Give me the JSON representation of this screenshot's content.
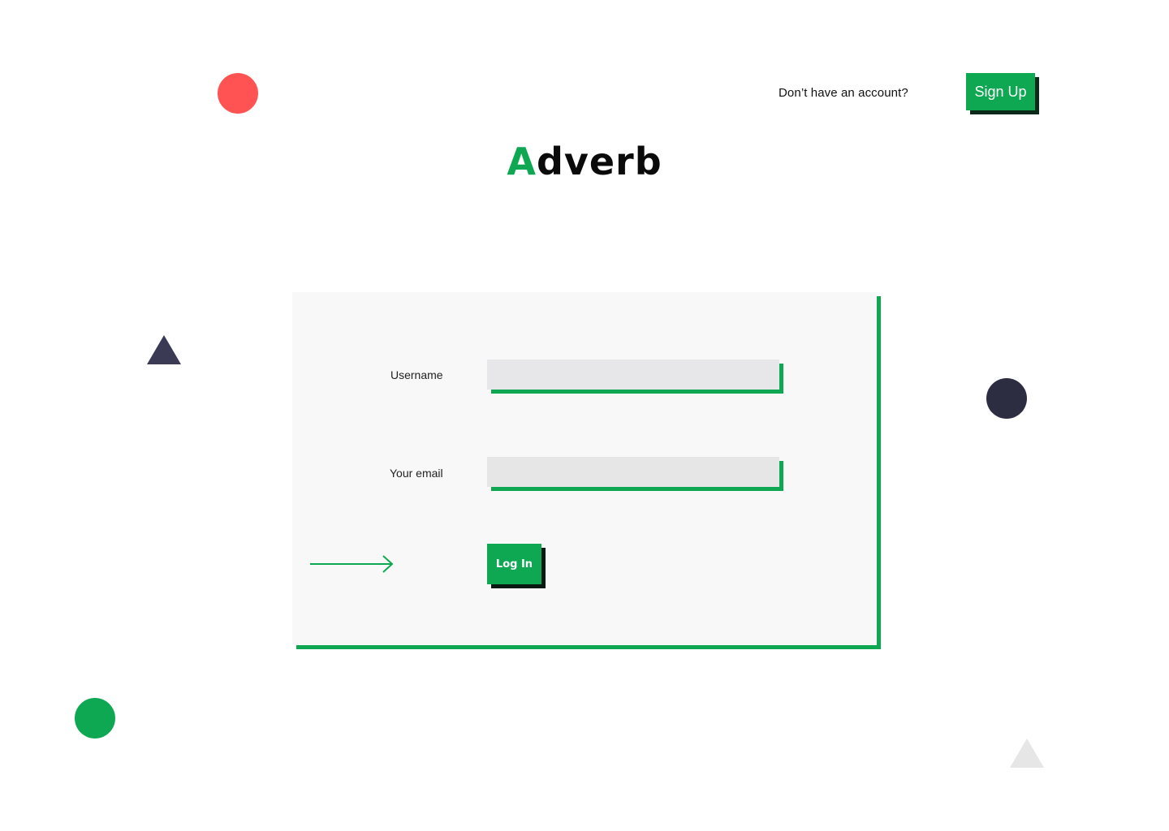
{
  "header": {
    "signup_prompt": "Don’t have an account?",
    "signup_label": "Sign Up"
  },
  "logo": {
    "accent_letter": "A",
    "rest": "dverb"
  },
  "form": {
    "username_label": "Username",
    "username_value": "",
    "email_label": "Your email",
    "email_value": "",
    "login_label": "Log In"
  },
  "colors": {
    "accent": "#0fa852",
    "red": "#ff5353",
    "dark": "#2d2d42",
    "card_bg": "#f8f8f8",
    "input_bg": "#e7e7ea"
  },
  "icons": {
    "arrow": "arrow-right-icon"
  }
}
